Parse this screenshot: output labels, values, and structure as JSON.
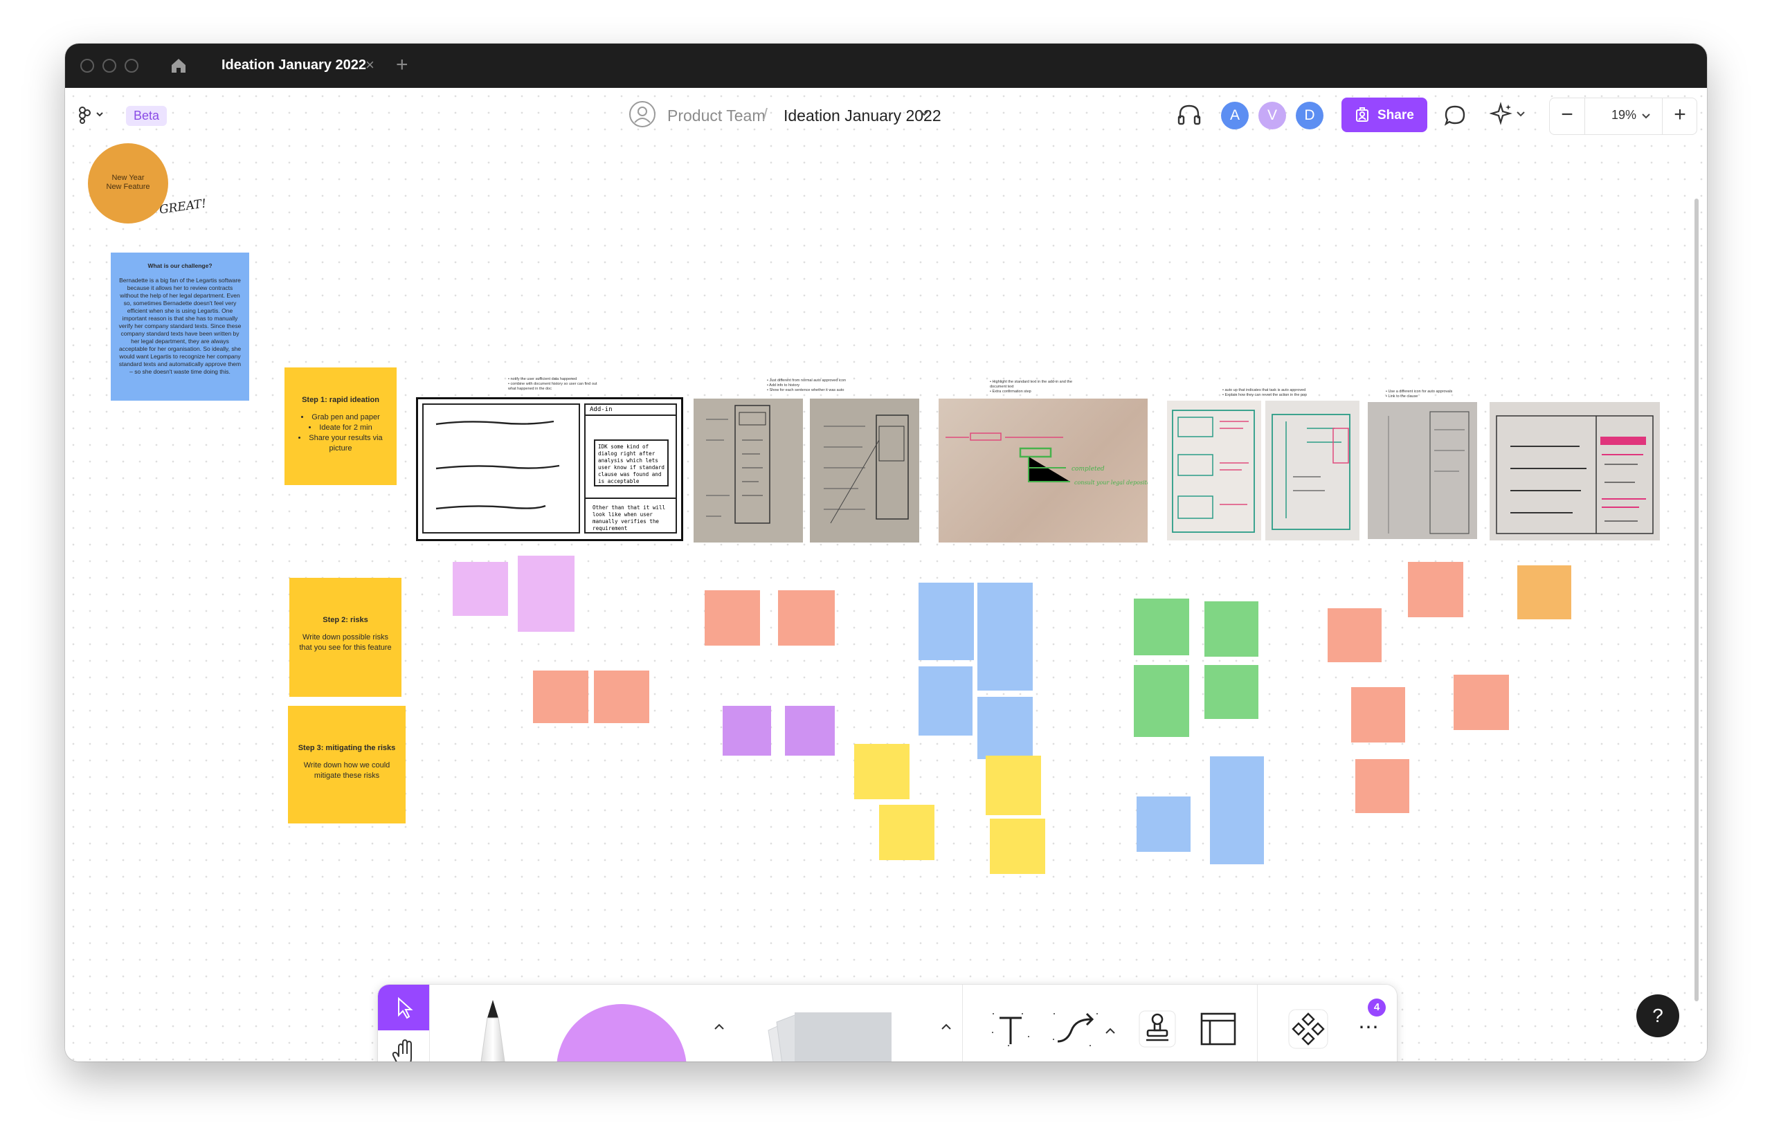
{
  "window": {
    "tab_title": "Ideation January 2022",
    "tab_close": "×",
    "tab_add": "+"
  },
  "header": {
    "beta": "Beta",
    "team": "Product Team",
    "slash": "/",
    "file_name": "Ideation January 2022",
    "avatars": [
      {
        "initial": "A",
        "color": "#5c8ef2"
      },
      {
        "initial": "V",
        "color": "#c6a9f7"
      },
      {
        "initial": "D",
        "color": "#5c8ef2"
      }
    ],
    "share": "Share",
    "zoom": "19%",
    "accent": "#9747ff"
  },
  "board": {
    "circle_line1": "New Year",
    "circle_line2": "New Feature",
    "great": "GREAT!",
    "challenge_title": "What is our challenge?",
    "challenge_body": "Bernadette is a big fan of the Legartis software because it allows her to review contracts without the help of her legal department. Even so, sometimes Bernadette doesn't feel very efficient when she is using Legartis. One important reason is that she has to manually verify her company standard texts. Since these company standard texts have been written by her legal department, they are always acceptable for her organisation. So ideally, she would want Legartis to recognize her company standard texts and automatically approve them – so she doesn't waste time doing this.",
    "step1_title": "Step 1: rapid ideation",
    "step1_items": [
      "Grab pen and paper",
      "Ideate for 2 min",
      "Share your results via picture"
    ],
    "step2_title": "Step 2: risks",
    "step2_body": "Write down possible risks that you see for this feature",
    "step3_title": "Step 3: mitigating the risks",
    "step3_body": "Write down how we could mitigate these risks",
    "wire_addin": "Add-in",
    "wire_dialog": "IDK some kind of dialog right after analysis which lets user know if standard clause was found and is acceptable",
    "wire_other": "Other than that it will look like when user manually verifies the requirement",
    "notes": [
      "• notify the user sufficient data happened\n• combine with document history so user can find out what happened in the doc",
      "• Just different from normal auto approved icon\n• Add info to history\n• Show for each sentence whether it was auto",
      "• Highlight the standard text in the add-in and the document text\n• Extra confirmation step",
      "• auto up that indicates that task is auto approved\n• Explain how they can revert the action in the pop",
      "• Use a different icon for auto approvals\n• Link to the clause"
    ],
    "photo_text": [
      "completed",
      "consult your legal depositor and/or use clause"
    ]
  },
  "toolbar": {
    "badge": "4",
    "caret": "^",
    "more": "⋯"
  },
  "help": "?"
}
